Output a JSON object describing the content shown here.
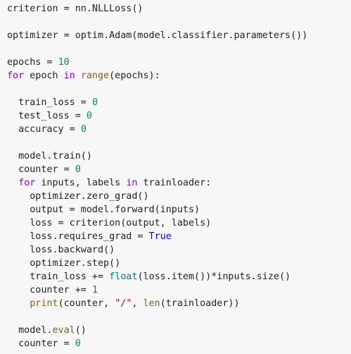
{
  "code": {
    "lines": [
      {
        "tokens": [
          {
            "text": "criterion = nn.NLLLoss()",
            "type": "plain"
          }
        ]
      },
      {
        "tokens": []
      },
      {
        "tokens": [
          {
            "text": "optimizer = optim.Adam(model.classifier.parameters())",
            "type": "plain"
          }
        ]
      },
      {
        "tokens": []
      },
      {
        "tokens": [
          {
            "text": "epochs = ",
            "type": "plain"
          },
          {
            "text": "10",
            "type": "num"
          }
        ]
      },
      {
        "tokens": [
          {
            "text": "for",
            "type": "kw"
          },
          {
            "text": " epoch ",
            "type": "plain"
          },
          {
            "text": "in",
            "type": "kw"
          },
          {
            "text": " ",
            "type": "plain"
          },
          {
            "text": "range",
            "type": "func"
          },
          {
            "text": "(epochs):",
            "type": "plain"
          }
        ]
      },
      {
        "tokens": []
      },
      {
        "tokens": [
          {
            "text": "  train_loss = ",
            "type": "plain"
          },
          {
            "text": "0",
            "type": "num"
          }
        ]
      },
      {
        "tokens": [
          {
            "text": "  test_loss = ",
            "type": "plain"
          },
          {
            "text": "0",
            "type": "num"
          }
        ]
      },
      {
        "tokens": [
          {
            "text": "  accuracy = ",
            "type": "plain"
          },
          {
            "text": "0",
            "type": "num"
          }
        ]
      },
      {
        "tokens": []
      },
      {
        "tokens": [
          {
            "text": "  model.train()",
            "type": "plain"
          }
        ]
      },
      {
        "tokens": [
          {
            "text": "  counter = ",
            "type": "plain"
          },
          {
            "text": "0",
            "type": "num"
          }
        ]
      },
      {
        "tokens": [
          {
            "text": "  ",
            "type": "plain"
          },
          {
            "text": "for",
            "type": "kw"
          },
          {
            "text": " inputs, labels ",
            "type": "plain"
          },
          {
            "text": "in",
            "type": "kw"
          },
          {
            "text": " trainloader:",
            "type": "plain"
          }
        ]
      },
      {
        "tokens": [
          {
            "text": "    optimizer.zero_grad()",
            "type": "plain"
          }
        ]
      },
      {
        "tokens": [
          {
            "text": "    output = model.forward(inputs)",
            "type": "plain"
          }
        ]
      },
      {
        "tokens": [
          {
            "text": "    loss = criterion(output, labels)",
            "type": "plain"
          }
        ]
      },
      {
        "tokens": [
          {
            "text": "    loss.requires_grad = ",
            "type": "plain"
          },
          {
            "text": "True",
            "type": "const"
          }
        ]
      },
      {
        "tokens": [
          {
            "text": "    loss.backward()",
            "type": "plain"
          }
        ]
      },
      {
        "tokens": [
          {
            "text": "    optimizer.step()",
            "type": "plain"
          }
        ]
      },
      {
        "tokens": [
          {
            "text": "    train_loss += ",
            "type": "plain"
          },
          {
            "text": "float",
            "type": "builtin"
          },
          {
            "text": "(loss.item())*inputs.size()",
            "type": "plain"
          }
        ]
      },
      {
        "tokens": [
          {
            "text": "    counter += ",
            "type": "plain"
          },
          {
            "text": "1",
            "type": "num"
          }
        ]
      },
      {
        "tokens": [
          {
            "text": "    ",
            "type": "plain"
          },
          {
            "text": "print",
            "type": "func"
          },
          {
            "text": "(counter, ",
            "type": "plain"
          },
          {
            "text": "\"/\"",
            "type": "str"
          },
          {
            "text": ", ",
            "type": "plain"
          },
          {
            "text": "len",
            "type": "func"
          },
          {
            "text": "(trainloader))",
            "type": "plain"
          }
        ]
      },
      {
        "tokens": []
      },
      {
        "tokens": [
          {
            "text": "  model.",
            "type": "plain"
          },
          {
            "text": "eval",
            "type": "func"
          },
          {
            "text": "()",
            "type": "plain"
          }
        ]
      },
      {
        "tokens": [
          {
            "text": "  counter = ",
            "type": "plain"
          },
          {
            "text": "0",
            "type": "num"
          }
        ]
      }
    ]
  }
}
